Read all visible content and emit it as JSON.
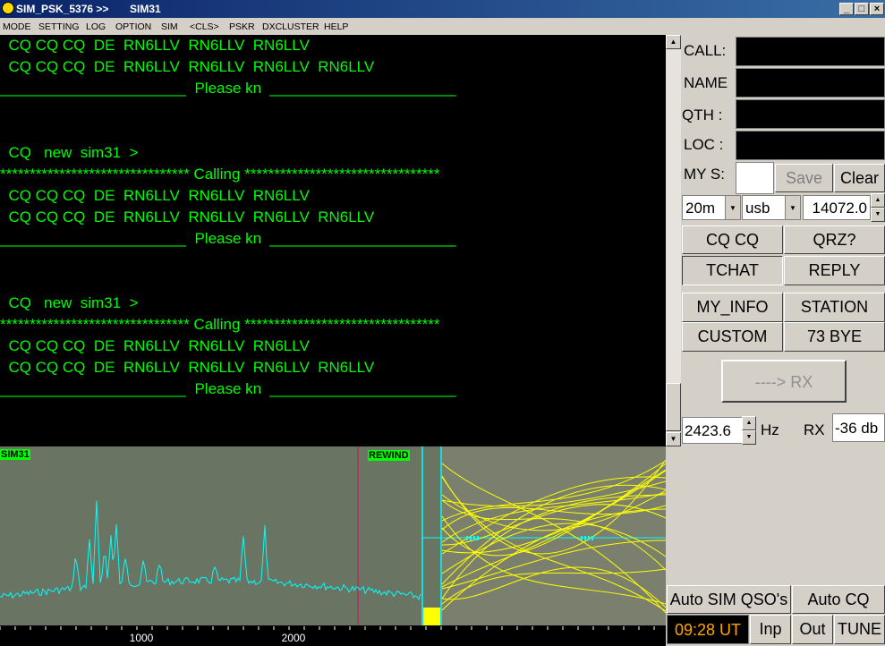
{
  "window": {
    "title": "SIM_PSK_5376  >>",
    "subtitle": "SIM31"
  },
  "menu": [
    "MODE",
    "SETTING",
    "LOG",
    "OPTION",
    "SIM",
    "<CLS>",
    "PSKR",
    "DXCLUSTER",
    "HELP"
  ],
  "chat_lines": [
    "  CQ CQ CQ  DE  RN6LLV  RN6LLV  RN6LLV",
    "  CQ CQ CQ  DE  RN6LLV  RN6LLV  RN6LLV  RN6LLV",
    "______________________  Please kn  ______________________",
    "",
    "",
    "  CQ   new  sim31  >",
    "******************************** Calling *********************************",
    "  CQ CQ CQ  DE  RN6LLV  RN6LLV  RN6LLV",
    "  CQ CQ CQ  DE  RN6LLV  RN6LLV  RN6LLV  RN6LLV",
    "______________________  Please kn  ______________________",
    "",
    "",
    "  CQ   new  sim31  >",
    "******************************** Calling *********************************",
    "  CQ CQ CQ  DE  RN6LLV  RN6LLV  RN6LLV",
    "  CQ CQ CQ  DE  RN6LLV  RN6LLV  RN6LLV  RN6LLV",
    "______________________  Please kn  ______________________"
  ],
  "qso": {
    "call_label": "CALL:",
    "name_label": "NAME",
    "qth_label": "QTH :",
    "loc_label": "LOC :",
    "mys_label": "MY S:",
    "save": "Save",
    "clear": "Clear",
    "band": "20m",
    "mode": "usb",
    "frequency": "14072.0"
  },
  "macros": {
    "cqcq": "CQ CQ",
    "qrz": "QRZ?",
    "tchat": "TCHAT",
    "reply": "REPLY",
    "myinfo": "MY_INFO",
    "station": "STATION",
    "custom": "CUSTOM",
    "bye": "73 BYE"
  },
  "rx": {
    "button": "----> RX",
    "hz_value": "2423.6",
    "hz_unit": "Hz",
    "rx_label": "RX",
    "db": "-36 db"
  },
  "spectrum": {
    "tag": "SIM31",
    "rewind": "REWIND",
    "tick1000": "1000",
    "tick2000": "2000"
  },
  "bottom": {
    "auto_sim": "Auto SIM QSO's",
    "auto_cq": "Auto CQ",
    "time": "09:28 UT",
    "inp": "Inp",
    "out": "Out",
    "tune": "TUNE"
  },
  "colors": {
    "text": "#00ff00",
    "spectrum": "#00ffff",
    "waterfall": "#ffff00",
    "clock": "#ffa500"
  }
}
